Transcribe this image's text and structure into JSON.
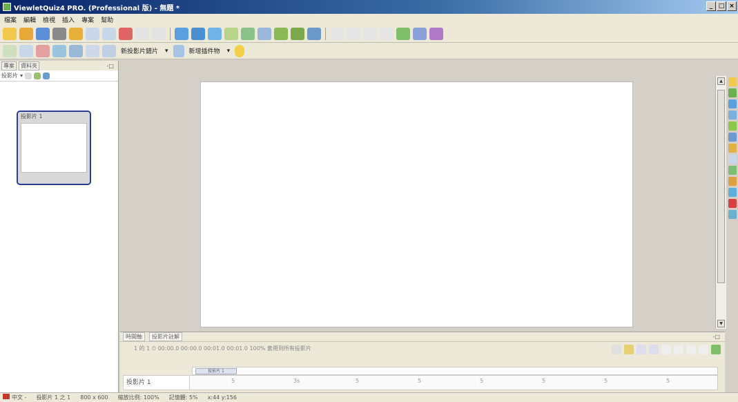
{
  "window": {
    "title": "ViewletQuiz4 PRO. (Professional 版) - 無題 *",
    "buttons": {
      "minimize": "_",
      "maximize": "□",
      "close": "×"
    }
  },
  "menubar": {
    "items": [
      "檔案",
      "編輯",
      "檢視",
      "插入",
      "專案",
      "幫助"
    ]
  },
  "toolbar2": {
    "new_slide_label": "新投影片錯片",
    "new_object_label": "新增插件物"
  },
  "left_panel": {
    "tabs": [
      "專案",
      "資料夾"
    ],
    "dropdown_label": "投影片",
    "thumbnail_label": "投影片 1"
  },
  "timeline": {
    "tabs": [
      "時間軸",
      "投影片註解"
    ],
    "controls_text": "1 的 1  ⏱ 00:00.0  00:00.0  00:01.0  00:01.0  100%  套用到所有投影片",
    "segment_label": "投影片 1",
    "row_label": "投影片 1",
    "ticks": [
      "5",
      "3s",
      "5",
      "5",
      "5",
      "5",
      "5",
      "5"
    ]
  },
  "statusbar": {
    "language": "中文 -",
    "slide_info": "投影片 1 之 1",
    "dimensions": "800 x 600",
    "zoom": "縮放比例: 100%",
    "memory": "記憶體: 5%",
    "coords": "x:44 y:156"
  },
  "colors": {
    "titlebar_start": "#0a246a",
    "accent": "#2a3f8f"
  }
}
